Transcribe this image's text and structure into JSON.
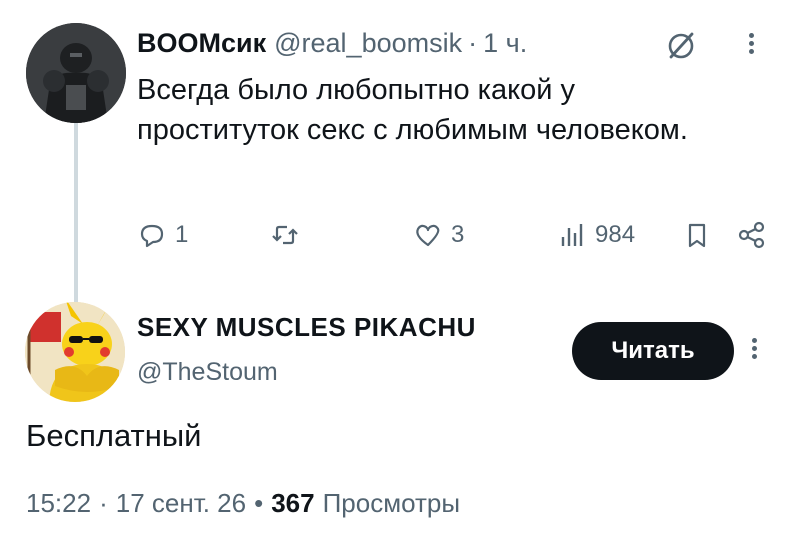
{
  "reply": {
    "author_name": "BOOMсик",
    "author_handle": "@real_boomsik",
    "dot": "·",
    "time": "1 ч.",
    "text": "Всегда было любопытно какой у проституток секс с любимым человеком.",
    "actions": {
      "replies": "1",
      "reposts": "",
      "likes": "3",
      "views": "984"
    }
  },
  "post": {
    "author_name": "SEXY MUSCLES PIKACHU",
    "author_handle": "@TheStoum",
    "follow_label": "Читать",
    "text": "Бесплатный",
    "time": "15:22",
    "dot1": "·",
    "date": "17 сент. 26",
    "dot2": "•",
    "views_count": "367",
    "views_label": "Просмотры"
  },
  "icons": {
    "grok": "grok-icon",
    "more": "more-vertical-icon",
    "reply": "comment-icon",
    "repost": "repost-icon",
    "like": "heart-icon",
    "views": "analytics-icon",
    "bookmark": "bookmark-icon",
    "share": "share-icon"
  },
  "colors": {
    "text_primary": "#0f1419",
    "text_secondary": "#536471",
    "thread_line": "#cfd9de",
    "button_bg": "#0f1419",
    "button_text": "#ffffff"
  }
}
